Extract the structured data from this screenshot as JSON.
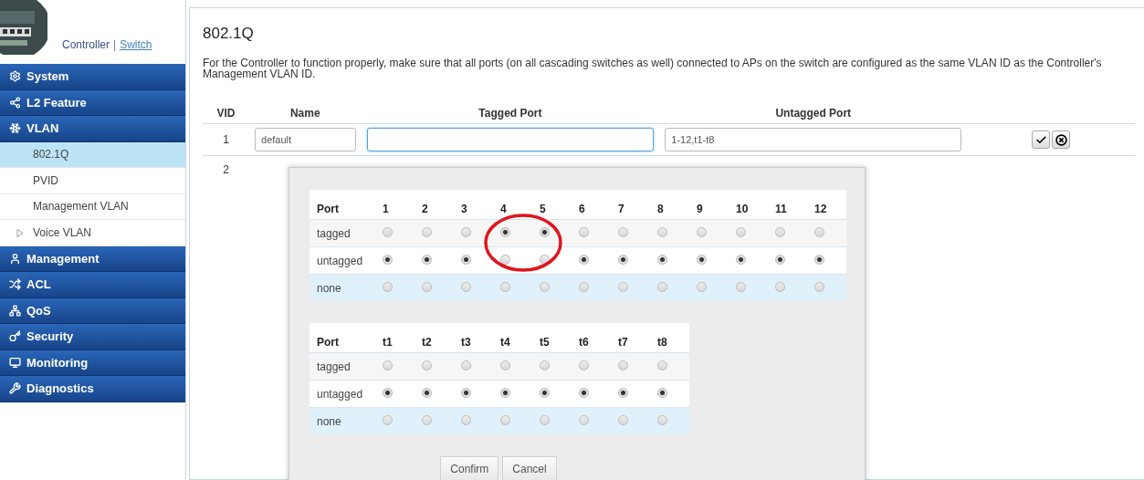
{
  "brand": {
    "separator": "|",
    "links": [
      {
        "label": "Controller",
        "selected": false
      },
      {
        "label": "Switch",
        "selected": true
      }
    ]
  },
  "sidebar": {
    "items": [
      {
        "kind": "section",
        "label": "System",
        "selected": false
      },
      {
        "kind": "section",
        "label": "L2 Feature",
        "selected": false
      },
      {
        "kind": "section",
        "label": "VLAN",
        "selected": false
      },
      {
        "kind": "sub",
        "label": "802.1Q",
        "selected": true
      },
      {
        "kind": "sub",
        "label": "PVID",
        "selected": false
      },
      {
        "kind": "sub",
        "label": "Management VLAN",
        "selected": false
      },
      {
        "kind": "sub",
        "label": "Voice VLAN",
        "selected": false,
        "expanded": false
      },
      {
        "kind": "section",
        "label": "Management",
        "selected": false
      },
      {
        "kind": "section",
        "label": "ACL",
        "selected": false
      },
      {
        "kind": "section",
        "label": "QoS",
        "selected": false
      },
      {
        "kind": "section",
        "label": "Security",
        "selected": false
      },
      {
        "kind": "section",
        "label": "Monitoring",
        "selected": false
      },
      {
        "kind": "section",
        "label": "Diagnostics",
        "selected": false
      }
    ]
  },
  "page": {
    "title": "802.1Q",
    "description": "For the Controller to function properly, make sure that all ports (on all cascading switches as well) connected to APs on the switch are configured as the same VLAN ID as the Controller's Management VLAN ID."
  },
  "vlan_table": {
    "columns": [
      "VID",
      "Name",
      "Tagged Port",
      "Untagged Port"
    ],
    "rows": [
      {
        "vid": "1",
        "name": "default",
        "tagged": "",
        "untagged": "1-12,t1-t8",
        "editing": true
      },
      {
        "vid": "2",
        "editing": false
      }
    ]
  },
  "port_dialog": {
    "tables": [
      {
        "header": "Port",
        "ports": [
          "1",
          "2",
          "3",
          "4",
          "5",
          "6",
          "7",
          "8",
          "9",
          "10",
          "11",
          "12"
        ],
        "rows": [
          {
            "label": "tagged",
            "radios": [
              {
                "selected": false
              },
              {
                "selected": false
              },
              {
                "selected": false
              },
              {
                "selected": true
              },
              {
                "selected": true
              },
              {
                "selected": false
              },
              {
                "selected": false
              },
              {
                "selected": false
              },
              {
                "selected": false
              },
              {
                "selected": false
              },
              {
                "selected": false
              },
              {
                "selected": false
              }
            ]
          },
          {
            "label": "untagged",
            "radios": [
              {
                "selected": true
              },
              {
                "selected": true
              },
              {
                "selected": true
              },
              {
                "selected": false
              },
              {
                "selected": false
              },
              {
                "selected": true
              },
              {
                "selected": true
              },
              {
                "selected": true
              },
              {
                "selected": true
              },
              {
                "selected": true
              },
              {
                "selected": true
              },
              {
                "selected": true
              }
            ]
          },
          {
            "label": "none",
            "radios": [
              {
                "selected": false
              },
              {
                "selected": false
              },
              {
                "selected": false
              },
              {
                "selected": false
              },
              {
                "selected": false
              },
              {
                "selected": false
              },
              {
                "selected": false
              },
              {
                "selected": false
              },
              {
                "selected": false
              },
              {
                "selected": false
              },
              {
                "selected": false
              },
              {
                "selected": false
              }
            ]
          }
        ]
      },
      {
        "header": "Port",
        "ports": [
          "t1",
          "t2",
          "t3",
          "t4",
          "t5",
          "t6",
          "t7",
          "t8"
        ],
        "rows": [
          {
            "label": "tagged",
            "radios": [
              {
                "selected": false
              },
              {
                "selected": false
              },
              {
                "selected": false
              },
              {
                "selected": false
              },
              {
                "selected": false
              },
              {
                "selected": false
              },
              {
                "selected": false
              },
              {
                "selected": false
              }
            ]
          },
          {
            "label": "untagged",
            "radios": [
              {
                "selected": true
              },
              {
                "selected": true
              },
              {
                "selected": true
              },
              {
                "selected": true
              },
              {
                "selected": true
              },
              {
                "selected": true
              },
              {
                "selected": true
              },
              {
                "selected": true
              }
            ]
          },
          {
            "label": "none",
            "radios": [
              {
                "selected": false
              },
              {
                "selected": false
              },
              {
                "selected": false
              },
              {
                "selected": false
              },
              {
                "selected": false
              },
              {
                "selected": false
              },
              {
                "selected": false
              },
              {
                "selected": false
              }
            ]
          }
        ]
      }
    ],
    "buttons": [
      "Confirm",
      "Cancel"
    ]
  }
}
